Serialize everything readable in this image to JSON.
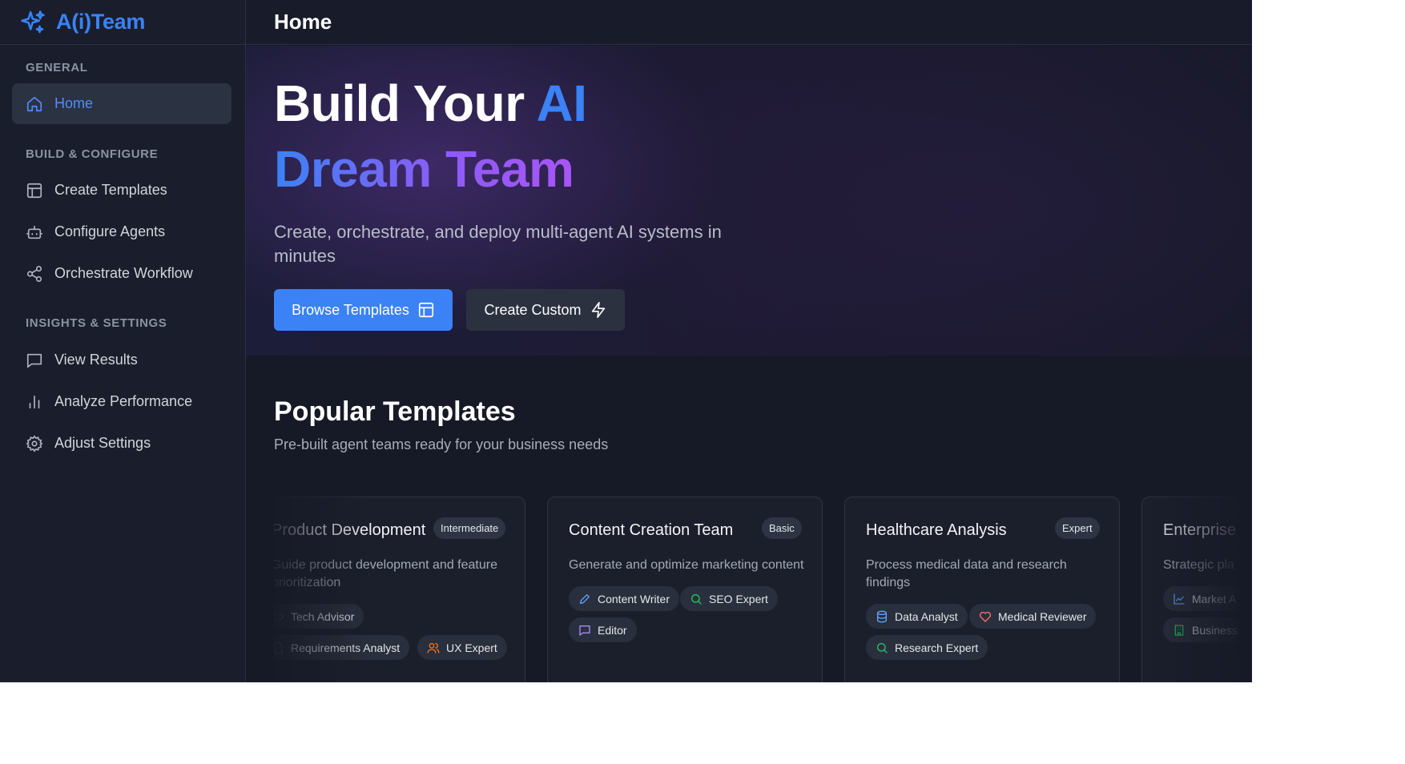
{
  "brand": {
    "name": "A(i)Team"
  },
  "sidebar": {
    "sections": [
      {
        "title": "GENERAL",
        "items": [
          {
            "label": "Home",
            "icon": "home-icon",
            "active": true
          }
        ]
      },
      {
        "title": "BUILD & CONFIGURE",
        "items": [
          {
            "label": "Create Templates",
            "icon": "layout-icon"
          },
          {
            "label": "Configure Agents",
            "icon": "bot-icon"
          },
          {
            "label": "Orchestrate Workflow",
            "icon": "share-icon"
          }
        ]
      },
      {
        "title": "INSIGHTS & SETTINGS",
        "items": [
          {
            "label": "View Results",
            "icon": "message-icon"
          },
          {
            "label": "Analyze Performance",
            "icon": "bar-chart-icon"
          },
          {
            "label": "Adjust Settings",
            "icon": "gear-icon"
          }
        ]
      }
    ]
  },
  "header": {
    "title": "Home"
  },
  "hero": {
    "line1_prefix": "Build Your",
    "line1_accent": "AI",
    "line2": "Dream Team",
    "subtitle": "Create, orchestrate, and deploy multi-agent AI systems in minutes",
    "primary_button": "Browse Templates",
    "secondary_button": "Create Custom"
  },
  "templates_section": {
    "title": "Popular Templates",
    "subtitle": "Pre-built agent teams ready for your business needs",
    "cards": [
      {
        "title": "Product Development",
        "level": "Intermediate",
        "description": "Guide product development and feature prioritization",
        "agents": [
          {
            "label": "Tech Advisor",
            "icon": "code-icon"
          },
          {
            "label": "Requirements Analyst",
            "icon": "file-icon"
          },
          {
            "label": "UX Expert",
            "icon": "users-icon"
          }
        ]
      },
      {
        "title": "Content Creation Team",
        "level": "Basic",
        "description": "Generate and optimize marketing content",
        "agents": [
          {
            "label": "Content Writer",
            "icon": "pen-icon"
          },
          {
            "label": "SEO Expert",
            "icon": "search-icon"
          },
          {
            "label": "Editor",
            "icon": "message-icon"
          }
        ]
      },
      {
        "title": "Healthcare Analysis",
        "level": "Expert",
        "description": "Process medical data and research findings",
        "agents": [
          {
            "label": "Data Analyst",
            "icon": "database-icon"
          },
          {
            "label": "Medical Reviewer",
            "icon": "heart-icon"
          },
          {
            "label": "Research Expert",
            "icon": "search-icon"
          }
        ]
      },
      {
        "title": "Enterprise",
        "level": "",
        "description": "Strategic pla",
        "agents": [
          {
            "label": "Market A",
            "icon": "line-chart-icon"
          },
          {
            "label": "Business",
            "icon": "building-icon"
          }
        ]
      }
    ]
  },
  "colors": {
    "accent": "#3b82f6",
    "gradient_end": "#a855f7",
    "background": "#161927",
    "sidebar": "#1a1e2c"
  }
}
